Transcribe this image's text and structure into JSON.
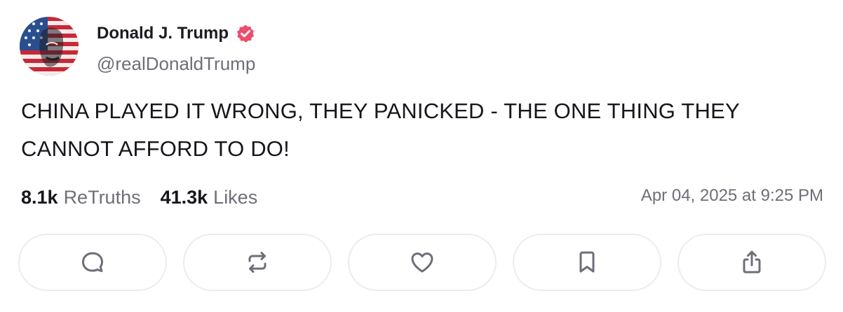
{
  "author": {
    "display_name": "Donald J. Trump",
    "handle": "@realDonaldTrump",
    "verified": true,
    "avatar_icon": "flag-portrait-avatar"
  },
  "post": {
    "text": "CHINA PLAYED IT WRONG, THEY PANICKED - THE ONE THING THEY CANNOT AFFORD TO DO!",
    "timestamp": "Apr 04, 2025 at 9:25 PM"
  },
  "stats": {
    "retruths": {
      "count": "8.1k",
      "label": "ReTruths"
    },
    "likes": {
      "count": "41.3k",
      "label": "Likes"
    }
  },
  "actions": [
    {
      "name": "reply",
      "icon": "comment-icon"
    },
    {
      "name": "retruth",
      "icon": "repost-icon"
    },
    {
      "name": "like",
      "icon": "heart-icon"
    },
    {
      "name": "bookmark",
      "icon": "bookmark-icon"
    },
    {
      "name": "share",
      "icon": "share-icon"
    }
  ],
  "colors": {
    "verified_badge": "#ec4d6d",
    "muted_text": "#6e6e78",
    "primary_text": "#16161c",
    "button_border": "#ececf0",
    "icon_stroke": "#6e6e78"
  }
}
